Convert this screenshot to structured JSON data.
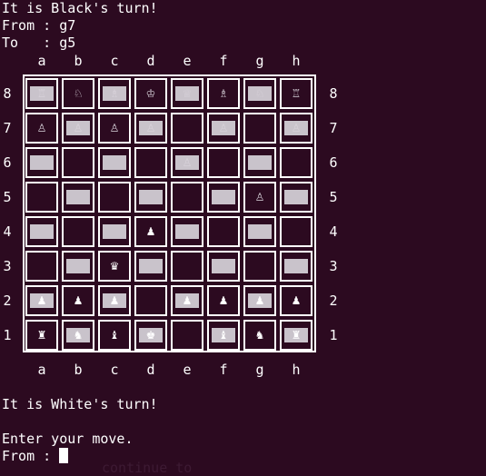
{
  "terminal": {
    "line1": "It is Black's turn!",
    "line2": "From : g7",
    "line3": "To   : g5",
    "line4": "It is White's turn!",
    "line5": "Enter your move.",
    "line6": "From : ",
    "ghost": "continue to"
  },
  "board": {
    "files": [
      "a",
      "b",
      "c",
      "d",
      "e",
      "f",
      "g",
      "h"
    ],
    "ranks": [
      "8",
      "7",
      "6",
      "5",
      "4",
      "3",
      "2",
      "1"
    ],
    "rows": [
      [
        "♖",
        "♘",
        "♗",
        "♔",
        "♕",
        "♗",
        "♘",
        "♖"
      ],
      [
        "♙",
        "♙",
        "♙",
        "♙",
        "",
        "♙",
        "",
        "♙"
      ],
      [
        "",
        "",
        "",
        "",
        "♙",
        "",
        "",
        ""
      ],
      [
        "",
        "",
        "",
        "",
        "",
        "",
        "♙",
        ""
      ],
      [
        "",
        "",
        "",
        "♟",
        "",
        "",
        "",
        ""
      ],
      [
        "",
        "",
        "♛",
        "",
        "",
        "",
        "",
        ""
      ],
      [
        "♟",
        "♟",
        "♟",
        "",
        "♟",
        "♟",
        "♟",
        "♟"
      ],
      [
        "♜",
        "♞",
        "♝",
        "♚",
        "",
        "♝",
        "♞",
        "♜"
      ]
    ]
  },
  "colors": {
    "background": "#2c0a20",
    "text": "#ffffff",
    "light_square_fill": "#c9c3cb"
  }
}
